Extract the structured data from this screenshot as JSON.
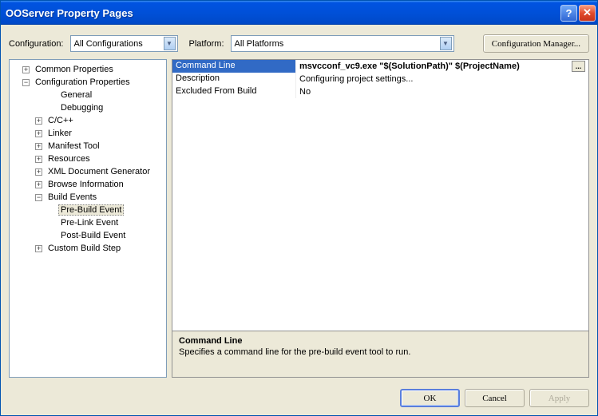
{
  "titlebar": {
    "title": "OOServer Property Pages"
  },
  "top": {
    "config_label": "Configuration:",
    "config_value": "All Configurations",
    "platform_label": "Platform:",
    "platform_value": "All Platforms",
    "cfgmgr_label": "Configuration Manager..."
  },
  "tree": {
    "common_properties": "Common Properties",
    "configuration_properties": "Configuration Properties",
    "general": "General",
    "debugging": "Debugging",
    "cpp": "C/C++",
    "linker": "Linker",
    "manifest_tool": "Manifest Tool",
    "resources": "Resources",
    "xml_doc": "XML Document Generator",
    "browse_info": "Browse Information",
    "build_events": "Build Events",
    "pre_build": "Pre-Build Event",
    "pre_link": "Pre-Link Event",
    "post_build": "Post-Build Event",
    "custom_build": "Custom Build Step"
  },
  "grid": {
    "rows": {
      "cmdline": {
        "name": "Command Line",
        "value": "msvcconf_vc9.exe \"$(SolutionPath)\" $(ProjectName)"
      },
      "desc": {
        "name": "Description",
        "value": "Configuring project settings..."
      },
      "excluded": {
        "name": "Excluded From Build",
        "value": "No"
      }
    },
    "ellipsis": "..."
  },
  "desc": {
    "title": "Command Line",
    "text": "Specifies a command line for the pre-build event tool to run."
  },
  "buttons": {
    "ok": "OK",
    "cancel": "Cancel",
    "apply": "Apply"
  }
}
